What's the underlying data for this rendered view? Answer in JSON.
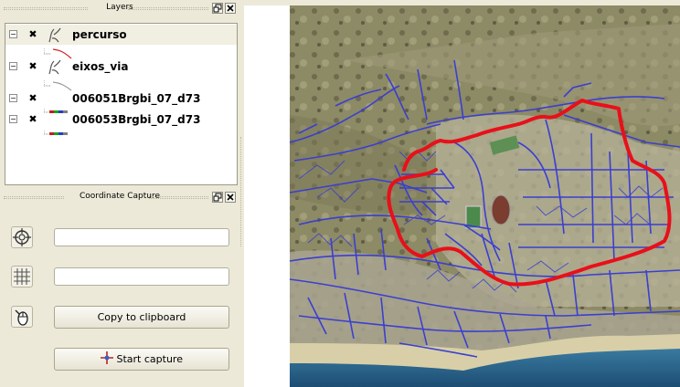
{
  "layers_dock": {
    "title": "Layers",
    "float_label": "🗗",
    "close_label": "✕",
    "layers": [
      {
        "name": "percurso",
        "visible_mark": "✖",
        "toggle": "⊟",
        "line_color": "#d42020",
        "selected": true
      },
      {
        "name": "eixos_via",
        "visible_mark": "✖",
        "toggle": "⊟",
        "line_color": "#888888",
        "selected": false
      },
      {
        "name": "006051Brgbi_07_d73",
        "visible_mark": "✖",
        "toggle": "⊟",
        "selected": false
      },
      {
        "name": "006053Brgbi_07_d73",
        "visible_mark": "✖",
        "toggle": "⊟",
        "selected": false
      }
    ]
  },
  "coordinate_capture": {
    "title": "Coordinate Capture",
    "float_label": "🗗",
    "close_label": "✕",
    "field1_value": "",
    "field2_value": "",
    "copy_label": "Copy to clipboard",
    "start_label": "Start capture"
  },
  "icons": {
    "crosshair": "crosshair-icon",
    "grid": "grid-icon",
    "mouse": "mouse-icon",
    "capture": "capture-cursor-icon"
  },
  "colors": {
    "route": "#e8101a",
    "roads": "#3a3fd0",
    "sea": "#2a5f8a"
  }
}
